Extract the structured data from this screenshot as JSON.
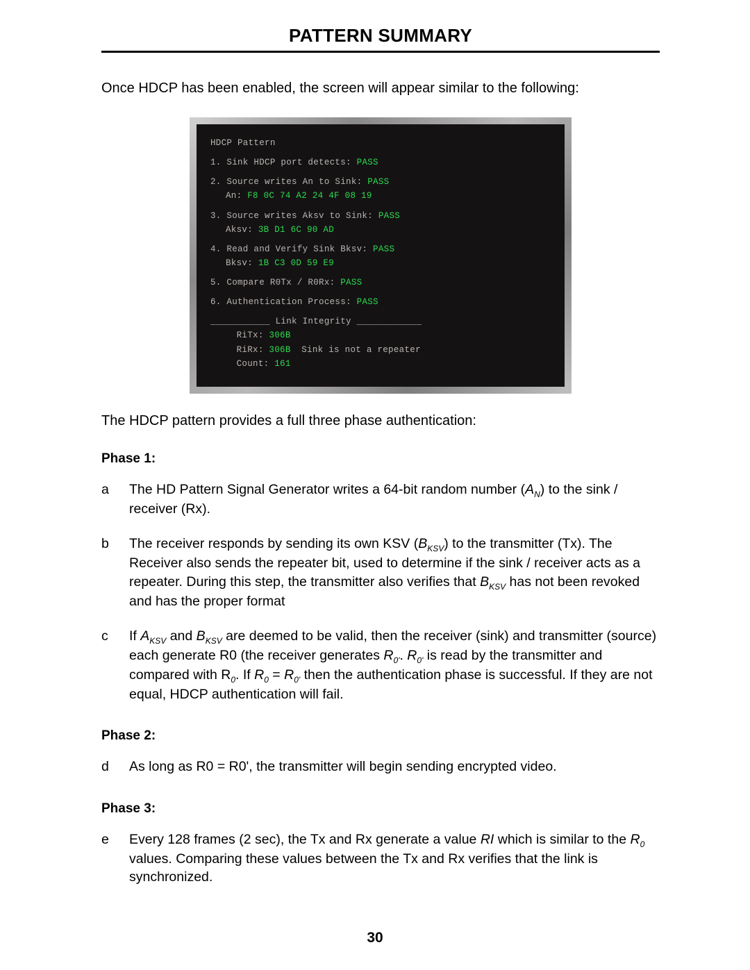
{
  "title": "PATTERN SUMMARY",
  "intro": "Once HDCP has been enabled, the screen will appear similar to the following:",
  "screen": {
    "header": "HDCP Pattern",
    "step1_label": "1. Sink HDCP port detects: ",
    "step1_status": "PASS",
    "step2_label": "2. Source writes An to Sink: ",
    "step2_status": "PASS",
    "step2_sub_label": "An: ",
    "step2_sub_val": "F8 0C 74 A2 24 4F 08 19",
    "step3_label": "3. Source writes Aksv to Sink: ",
    "step3_status": "PASS",
    "step3_sub_label": "Aksv: ",
    "step3_sub_val": "3B D1 6C 90 AD",
    "step4_label": "4. Read and Verify Sink Bksv: ",
    "step4_status": "PASS",
    "step4_sub_label": "Bksv: ",
    "step4_sub_val": "1B C3 0D 59 E9",
    "step5_label": "5. Compare R0Tx / R0Rx: ",
    "step5_status": "PASS",
    "step6_label": "6. Authentication Process: ",
    "step6_status": "PASS",
    "li_header": "___________ Link Integrity ____________",
    "ritx_label": "RiTx: ",
    "ritx_val": "306B",
    "rirx_label": "RiRx: ",
    "rirx_val": "306B",
    "rirx_tail": "  Sink is not a repeater",
    "count_label": "Count: ",
    "count_val": "161"
  },
  "note": "The HDCP pattern provides a full three phase authentication:",
  "phase1": {
    "label": "Phase 1:",
    "a_letter": "a",
    "a_t1": "The HD Pattern Signal Generator writes a 64-bit random number (",
    "a_var": "A",
    "a_sub": "N",
    "a_t2": ") to the sink / receiver (Rx).",
    "b_letter": "b",
    "b_t1": "The receiver responds by sending its own KSV (",
    "b_var1": "B",
    "b_sub1": "KSV",
    "b_t2": ") to the transmitter (Tx).  The Receiver also sends the repeater bit, used to determine if the sink / receiver acts as a repeater.  During this step, the transmitter also verifies that ",
    "b_var2": "B",
    "b_sub2": "KSV",
    "b_t3": " has not been revoked and has the proper format",
    "c_letter": "c",
    "c_t1": "If ",
    "c_var1": "A",
    "c_sub1": "KSV",
    "c_t2": " and ",
    "c_var2": "B",
    "c_sub2": "KSV",
    "c_t3": " are deemed to be valid, then the receiver (sink) and transmitter (source) each generate R0 (the receiver generates ",
    "c_var3": "R",
    "c_sub3": "0'",
    "c_t4": ".  ",
    "c_var4": "R",
    "c_sub4": "0'",
    "c_t5": " is read by the transmitter and compared with R",
    "c_sub5": "0",
    "c_t6": ".  If ",
    "c_var5": "R",
    "c_sub6": "0",
    "c_t7": " = ",
    "c_var6": "R",
    "c_sub7": "0'",
    "c_t8": " then the authentication phase is successful.  If they are not equal, HDCP authentication will fail."
  },
  "phase2": {
    "label": "Phase 2:",
    "d_letter": "d",
    "d_text": "As long as R0 = R0', the transmitter will begin sending encrypted video."
  },
  "phase3": {
    "label": "Phase 3:",
    "e_letter": "e",
    "e_t1": "Every 128 frames (2 sec), the Tx and Rx generate a value ",
    "e_var1": "RI",
    "e_t2": " which is similar to the ",
    "e_var2": "R",
    "e_sub2": "0",
    "e_t3": " values.  Comparing these values between the Tx and Rx verifies that the link is synchronized."
  },
  "page_number": "30"
}
